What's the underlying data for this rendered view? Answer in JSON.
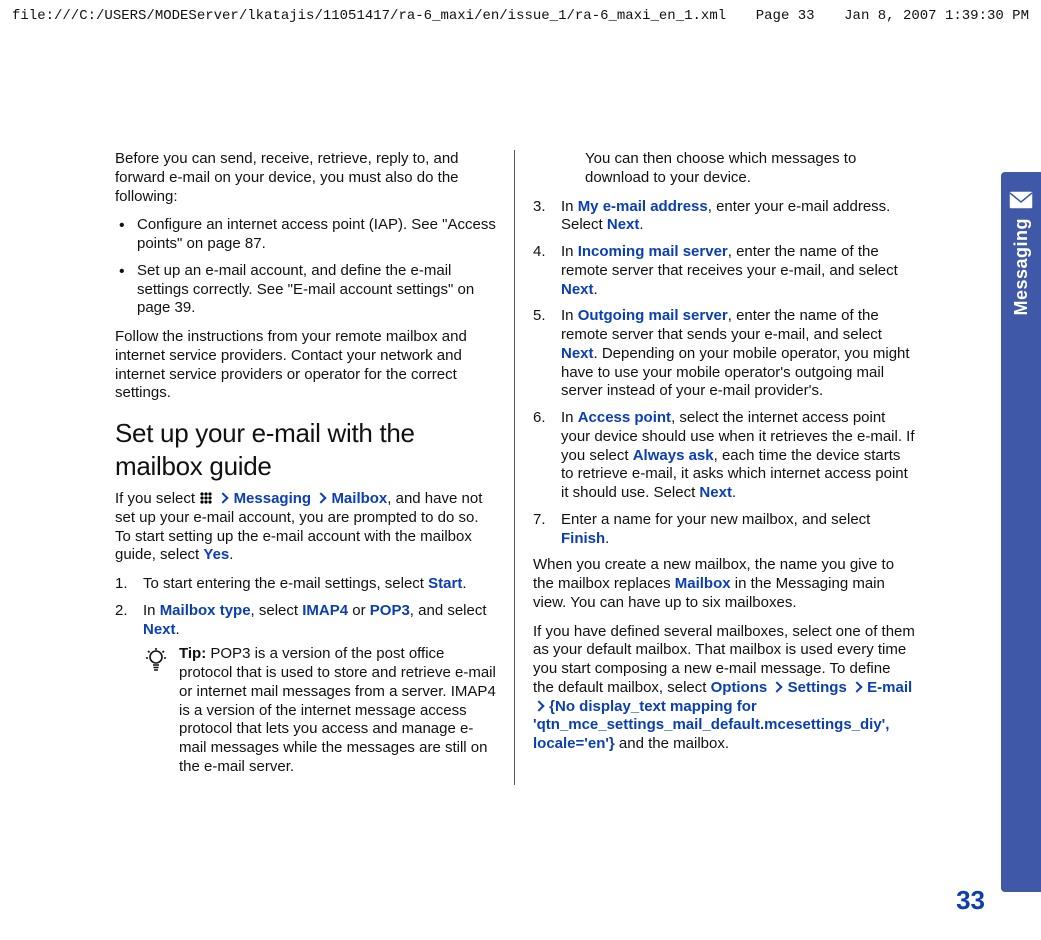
{
  "header": {
    "path": "file:///C:/USERS/MODEServer/lkatajis/11051417/ra-6_maxi/en/issue_1/ra-6_maxi_en_1.xml",
    "page": "Page 33",
    "datetime": "Jan 8, 2007 1:39:30 PM"
  },
  "side": {
    "label": "Messaging"
  },
  "page_number": "33",
  "left": {
    "intro": "Before you can send, receive, retrieve, reply to, and forward e-mail on your device, you must also do the following:",
    "bullets": [
      "Configure an internet access point (IAP). See \"Access points\" on page 87.",
      "Set up an e-mail account, and define the e-mail settings correctly. See \"E-mail account settings\" on page 39."
    ],
    "follow": "Follow the instructions from your remote mailbox and internet service providers. Contact your network and internet service providers or operator for the correct settings.",
    "section_title": "Set up your e-mail with the mailbox guide",
    "guide_pre": "If you select ",
    "guide_link1": "Messaging",
    "guide_link2": "Mailbox",
    "guide_post": ", and have not set up your e-mail account, you are prompted to do so. To start setting up the e-mail account with the mailbox guide, select ",
    "guide_yes": "Yes",
    "step1_pre": "To start entering the e-mail settings, select ",
    "step1_link": "Start",
    "step2_pre": "In ",
    "step2_l1": "Mailbox type",
    "step2_mid1": ", select ",
    "step2_l2": "IMAP4",
    "step2_mid2": " or ",
    "step2_l3": "POP3",
    "step2_mid3": ", and select ",
    "step2_l4": "Next",
    "tip_label": "Tip:",
    "tip_text": " POP3 is a version of the post office protocol that is used to store and retrieve e-mail or internet mail messages from a server. IMAP4 is a version of the internet message access protocol that lets you access and manage e-mail messages while the messages are still on the e-mail server."
  },
  "right": {
    "cont": "You can then choose which messages to download to your device.",
    "s3_pre": "In ",
    "s3_l1": "My e-mail address",
    "s3_mid": ", enter your e-mail address. Select ",
    "s3_l2": "Next",
    "s4_pre": "In ",
    "s4_l1": "Incoming mail server",
    "s4_mid": ", enter the name of the remote server that receives your e-mail, and select ",
    "s4_l2": "Next",
    "s5_pre": "In ",
    "s5_l1": "Outgoing mail server",
    "s5_mid": ", enter the name of the remote server that sends your e-mail, and select ",
    "s5_l2": "Next",
    "s5_post": ". Depending on your mobile operator, you might have to use your mobile operator's outgoing mail server instead of your e-mail provider's.",
    "s6_pre": "In ",
    "s6_l1": "Access point",
    "s6_mid": ", select the internet access point your device should use when it retrieves the e-mail. If you select ",
    "s6_l2": "Always ask",
    "s6_mid2": ", each time the device starts to retrieve e-mail, it asks which internet access point it should use. Select ",
    "s6_l3": "Next",
    "s7_pre": "Enter a name for your new mailbox, and select ",
    "s7_l1": "Finish",
    "after1_pre": "When you create a new mailbox, the name you give to the mailbox replaces ",
    "after1_l1": "Mailbox",
    "after1_post": " in the Messaging main view. You can have up to six mailboxes.",
    "after2_pre": "If you have defined several mailboxes, select one of them as your default mailbox. That mailbox is used every time you start composing a new e-mail message. To define the default mailbox, select ",
    "after2_l1": "Options",
    "after2_l2": "Settings",
    "after2_l3": "E-mail",
    "after2_l4": "{No display_text mapping for 'qtn_mce_settings_mail_default.mcesettings_diy', locale='en'}",
    "after2_post": " and the mailbox."
  }
}
